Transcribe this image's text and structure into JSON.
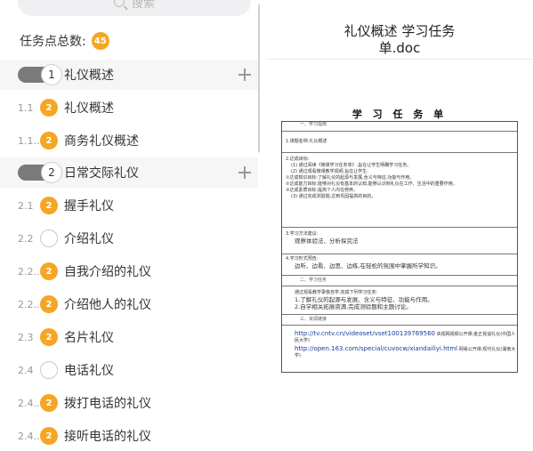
{
  "left_panel": {
    "search": {
      "placeholder": "搜索",
      "icon": "search-icon"
    },
    "task_count": {
      "label": "任务点总数:",
      "value": "45"
    },
    "rows": [
      {
        "kind": "section",
        "toggle_num": "1",
        "label": "礼仪概述"
      },
      {
        "kind": "item",
        "num": "1.1",
        "badge": "2",
        "label": "礼仪概述"
      },
      {
        "kind": "item",
        "num": "1.1...",
        "badge": "2",
        "label": "商务礼仪概述"
      },
      {
        "kind": "section",
        "toggle_num": "2",
        "label": "日常交际礼仪"
      },
      {
        "kind": "item",
        "num": "2.1",
        "badge": "2",
        "label": "握手礼仪"
      },
      {
        "kind": "item",
        "num": "2.2",
        "badge": "",
        "label": "介绍礼仪"
      },
      {
        "kind": "item",
        "num": "2.2...",
        "badge": "2",
        "label": "自我介绍的礼仪"
      },
      {
        "kind": "item",
        "num": "2.2...",
        "badge": "2",
        "label": "介绍他人的礼仪"
      },
      {
        "kind": "item",
        "num": "2.3",
        "badge": "2",
        "label": "名片礼仪"
      },
      {
        "kind": "item",
        "num": "2.4",
        "badge": "",
        "label": "电话礼仪"
      },
      {
        "kind": "item",
        "num": "2.4...",
        "badge": "2",
        "label": "拨打电话的礼仪"
      },
      {
        "kind": "item",
        "num": "2.4...",
        "badge": "2",
        "label": "接听电话的礼仪"
      }
    ],
    "accent": "#f5a623"
  },
  "right_panel": {
    "title_line1": "礼仪概述 学习任务",
    "title_line2": "单.doc",
    "sheet_title": "学 习 任 务 单",
    "doc": {
      "s1_header": "一、学习指南",
      "s1_course": "1.课题名称:礼仪概述",
      "s1_goal_title": "2.达成目标:",
      "s1_goal_1": "(1) 通过阅读《微课学习任务单》,旨在让学生明确学习任务。",
      "s1_goal_2": "(2) 通过观看微课教学视频,旨在让学生:",
      "s1_goal_3": "①达成知识目标:了解礼仪的起源与发展,含义与特征,功能与作用。",
      "s1_goal_4": "②达成能力目标:能够对礼仪有基本的认知,能够认识到礼仪在工作、生活中的重要作用。",
      "s1_goal_5": "③达成素质目标:提高个人内在修养。",
      "s1_goal_6": "(3) 通过完成测验题,达到巩固提高的目的。",
      "s1_method_title": "3.学习方法建议:",
      "s1_method": "观察体验法、分析探究法",
      "s1_form_title": "4.学习形式预告:",
      "s1_form": "边听、边看、边思、边练,在轻松的氛围中掌握所学知识。",
      "s2_header": "二、学习任务",
      "s2_intro": "通过观看教学录像自学,完成下列学习任务:",
      "s2_task1": "1.了解礼仪的起源与发展、含义与特征、功能与作用。",
      "s2_task2": "2.自学相关拓展资源,完成测验题和主题讨论。",
      "s3_header": "三、资源链接",
      "s3_link1": "http://tv.cntv.cn/videoset/vset100139769560",
      "s3_link1_note": "央视网视频公开课:金正昆谈礼仪(中国人民大学)",
      "s3_link2": "http://open.163.com/special/cuvocw/xiandailiyi.html",
      "s3_link2_note": "网易公开课:现代礼仪(湖南大学)"
    }
  }
}
